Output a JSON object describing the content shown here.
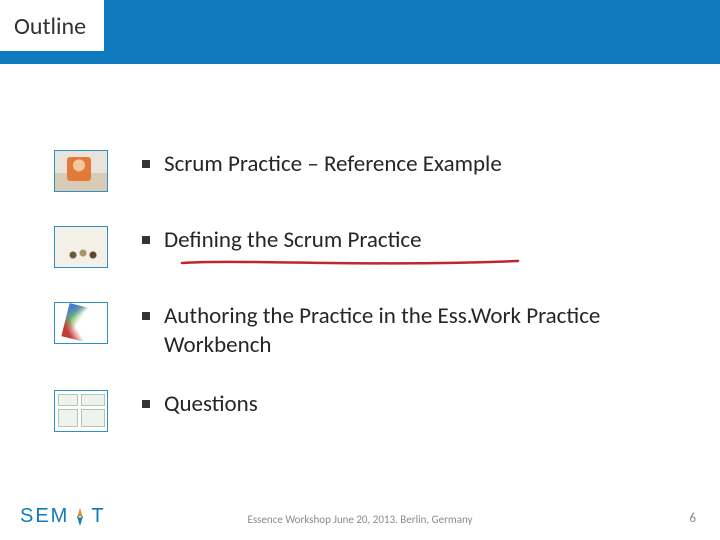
{
  "header": {
    "title": "Outline"
  },
  "items": [
    {
      "text": "Scrum Practice – Reference Example",
      "highlighted": false
    },
    {
      "text": "Defining the Scrum Practice",
      "highlighted": true
    },
    {
      "text": "Authoring the Practice in the Ess.Work Practice Workbench",
      "highlighted": false
    },
    {
      "text": "Questions",
      "highlighted": false
    }
  ],
  "footer": {
    "text": "Essence Workshop June 20, 2013. Berlin, Germany"
  },
  "page_number": "6",
  "logo": {
    "prefix": "SEM",
    "suffix": "T"
  },
  "colors": {
    "brand": "#0f7bbe",
    "underline": "#c0272a"
  }
}
